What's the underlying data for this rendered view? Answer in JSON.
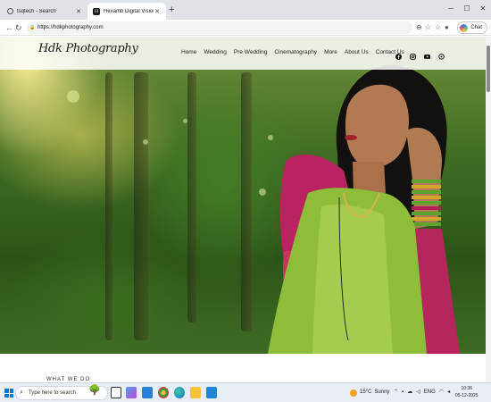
{
  "browser": {
    "tabs": [
      {
        "title": "tsqtech - Search",
        "icon": "search-icon"
      },
      {
        "title": "Hexamb Digital Vision",
        "icon": "site-favicon"
      }
    ],
    "new_tab": "+",
    "window_controls": [
      "─",
      "☐",
      "✕"
    ],
    "url": "https://hdkphotography.com",
    "copilot_label": "Chat"
  },
  "site": {
    "logo": "Hdk Photography",
    "menu": [
      "Home",
      "Wedding",
      "Pre Wedding",
      "Cinematography",
      "More",
      "About Us",
      "Contact Us"
    ],
    "social_icons": [
      "facebook-icon",
      "instagram-icon",
      "youtube-icon",
      "whatsapp-icon"
    ],
    "section_heading": "WHAT WE DO"
  },
  "taskbar": {
    "search_placeholder": "Type here to search",
    "weather_temp": "15°C",
    "weather_desc": "Sunny",
    "language": "ENG",
    "time": "10:36",
    "date": "05-12-2025"
  }
}
